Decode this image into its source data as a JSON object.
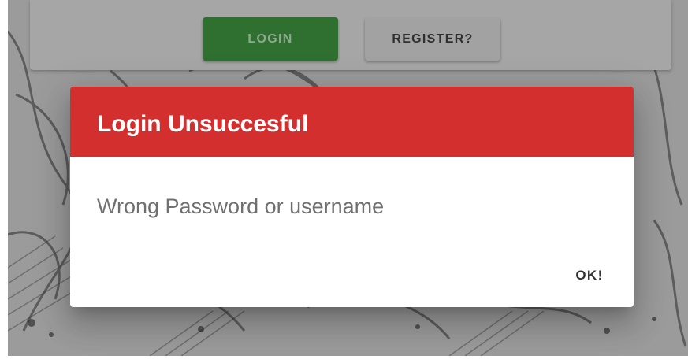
{
  "auth_bar": {
    "login_label": "LOGIN",
    "register_label": "REGISTER?"
  },
  "dialog": {
    "title": "Login Unsuccesful",
    "message": "Wrong Password or username",
    "ok_label": "OK!"
  },
  "colors": {
    "dialog_header": "#d32f2f",
    "login_button": "#2f6f2f",
    "overlay_bg": "#9a9a9a"
  },
  "background": {
    "icon": "manga-artwork-background"
  }
}
